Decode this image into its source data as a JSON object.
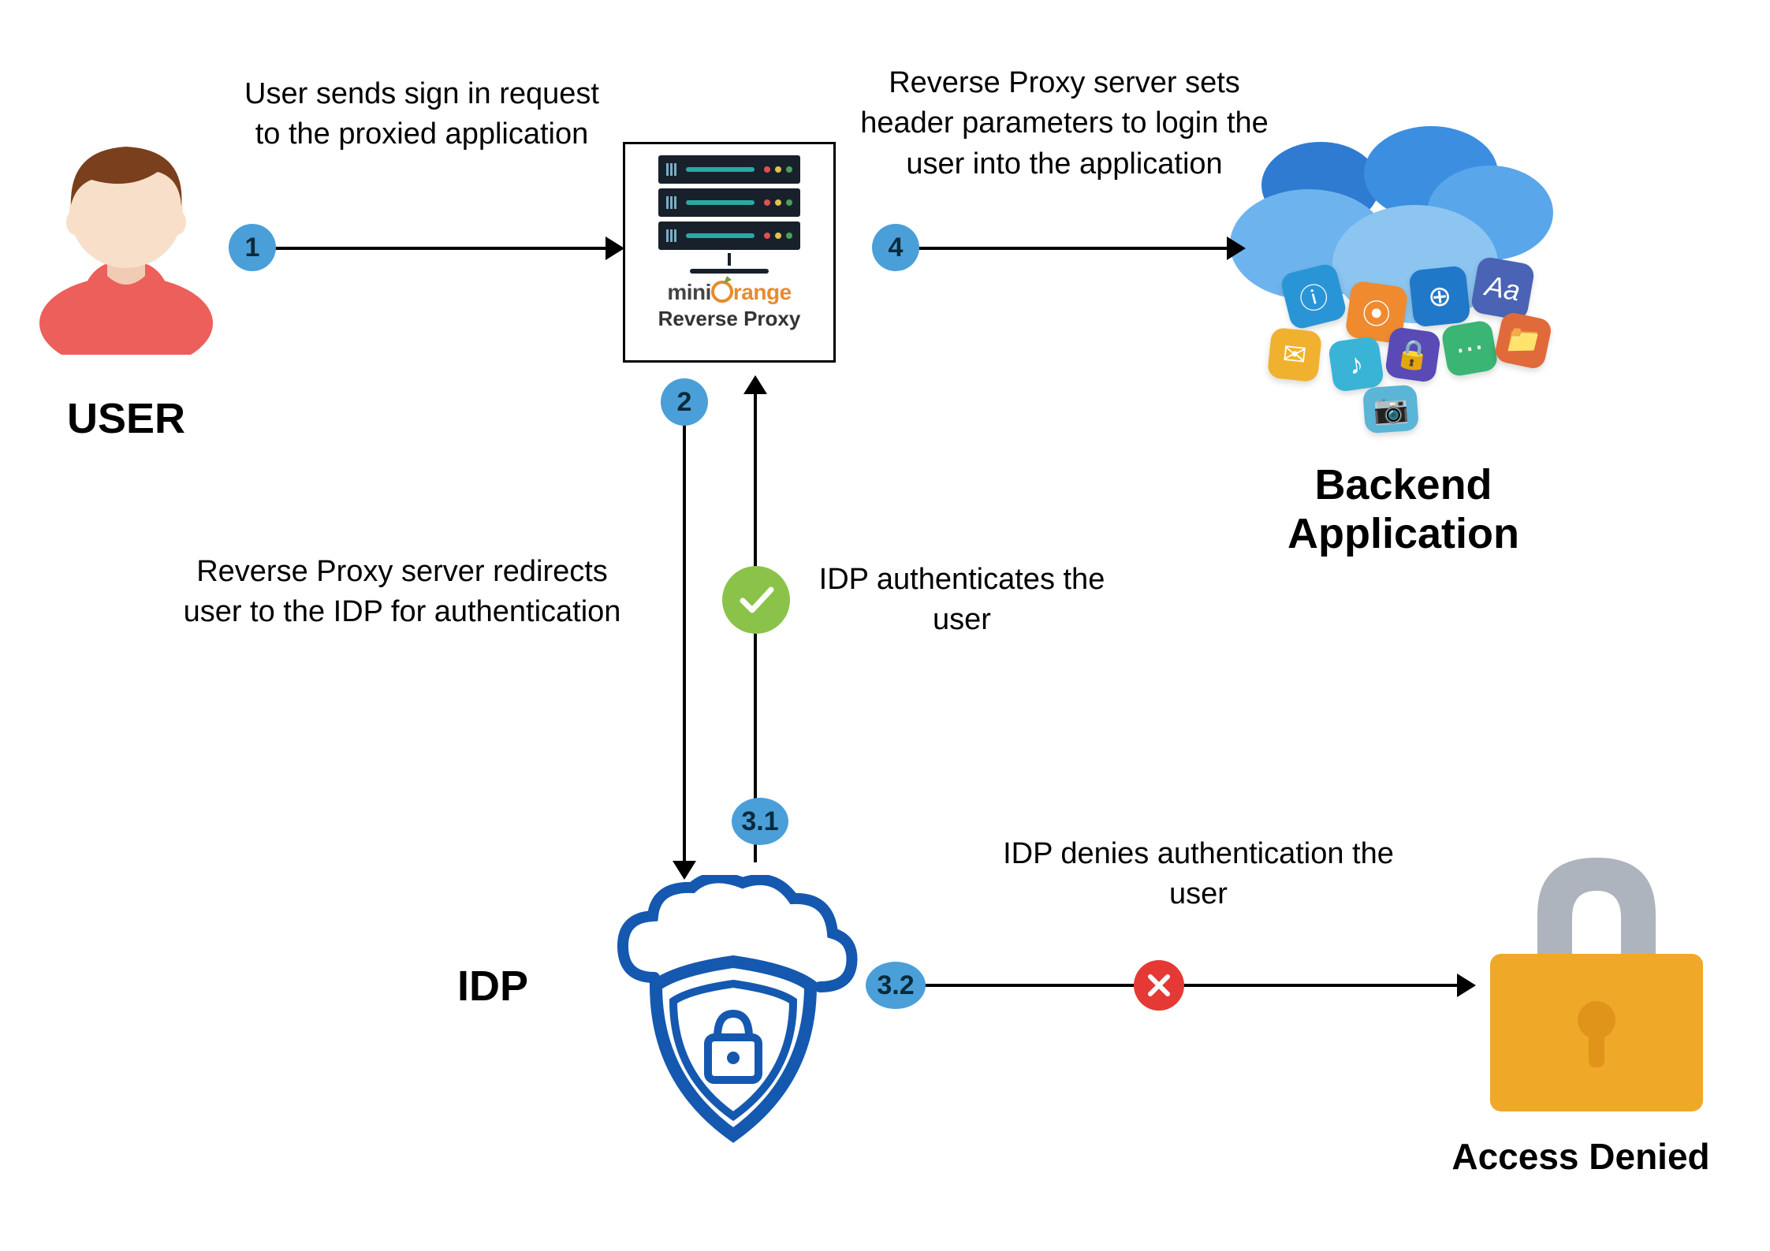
{
  "nodes": {
    "user_label": "USER",
    "proxy_brand_prefix": "mini",
    "proxy_brand_suffix": "range",
    "proxy_subtitle": "Reverse Proxy",
    "idp_label": "IDP",
    "backend_label_line1": "Backend",
    "backend_label_line2": "Application",
    "access_denied_label": "Access Denied"
  },
  "steps": {
    "s1": {
      "badge": "1",
      "text": "User sends sign in request to the proxied application"
    },
    "s2": {
      "badge": "2",
      "text": "Reverse Proxy server redirects user to the IDP for authentication"
    },
    "s3_1": {
      "badge": "3.1",
      "text": "IDP authenticates the user"
    },
    "s3_2": {
      "badge": "3.2",
      "text": "IDP denies authentication the user"
    },
    "s4": {
      "badge": "4",
      "text": "Reverse Proxy server sets header parameters to login the user into the application"
    }
  },
  "icons": {
    "checkmark": "check-icon",
    "cross": "cross-icon"
  },
  "colors": {
    "badge_blue": "#4a9fd8",
    "check_green": "#8bc34a",
    "cross_red": "#e53935",
    "brand_orange": "#e78b2e",
    "cloud_blue": "#3b8ee0",
    "lock_body": "#f0a828",
    "lock_shackle": "#aeb4bd",
    "idp_blue": "#1558b0"
  }
}
